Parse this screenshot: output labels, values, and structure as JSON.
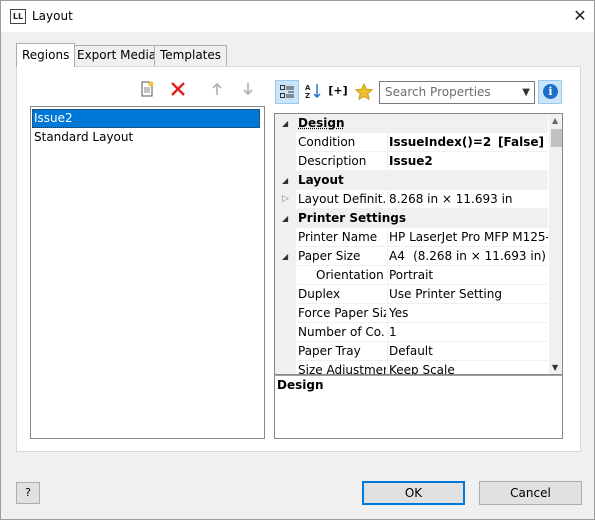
{
  "window": {
    "title": "Layout",
    "app_icon_text": "LL"
  },
  "tabs": [
    {
      "label": "Regions",
      "active": true
    },
    {
      "label": "Export Media",
      "active": false
    },
    {
      "label": "Templates",
      "active": false
    }
  ],
  "regions": {
    "items": [
      {
        "label": "Issue2",
        "selected": true
      },
      {
        "label": "Standard Layout",
        "selected": false
      }
    ]
  },
  "search": {
    "placeholder": "Search Properties"
  },
  "toolbar_icons": {
    "new": "new-region-icon",
    "delete": "delete-icon",
    "up": "arrow-up-icon",
    "down": "arrow-down-icon",
    "categorized": "categorized-view-icon",
    "sort": "sort-az-icon",
    "formula": "formula-icon",
    "favorites": "star-icon",
    "info": "info-icon"
  },
  "properties": {
    "design_category": "Design",
    "condition_name": "Condition",
    "condition_value": "IssueIndex()=2",
    "condition_flag": "[False]",
    "description_name": "Description",
    "description_value": "Issue2",
    "layout_category": "Layout",
    "layout_def_name": "Layout Definit...",
    "layout_def_value": "8.268 in × 11.693 in",
    "printer_category": "Printer Settings",
    "printer_name_name": "Printer Name",
    "printer_name_value": "HP LaserJet Pro MFP M125-...",
    "paper_size_name": "Paper Size",
    "paper_size_value": "A4",
    "paper_size_dims": "(8.268 in × 11.693 in)",
    "orientation_name": "Orientation",
    "orientation_value": "Portrait",
    "duplex_name": "Duplex",
    "duplex_value": "Use Printer Setting",
    "force_paper_name": "Force Paper Size",
    "force_paper_value": "Yes",
    "copies_name": "Number of Co...",
    "copies_value": "1",
    "paper_tray_name": "Paper Tray",
    "paper_tray_value": "Default",
    "size_adj_name": "Size Adjustment",
    "size_adj_value": "Keep Scale"
  },
  "description_panel": {
    "title": "Design"
  },
  "buttons": {
    "ok": "OK",
    "cancel": "Cancel",
    "help_glyph": "?"
  }
}
